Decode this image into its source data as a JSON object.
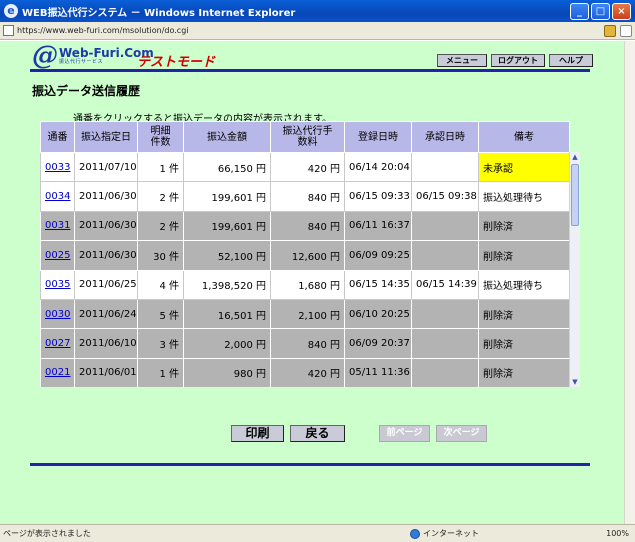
{
  "window": {
    "title": "WEB振込代行システム － Windows Internet Explorer"
  },
  "address": {
    "url": "https://www.web-furi.com/msolution/do.cgi"
  },
  "header": {
    "logo_name": "Web-Furi.Com",
    "logo_sub": "振込代行サービス",
    "mode": "テストモード",
    "nav": [
      "メニュー",
      "ログアウト",
      "ヘルプ"
    ]
  },
  "main": {
    "title": "振込データ送信履歴",
    "hint": "通番をクリックすると振込データの内容が表示されます。",
    "columns": [
      "通番",
      "振込指定日",
      "明細件数",
      "振込金額",
      "振込代行手数料",
      "登録日時",
      "承認日時",
      "備考"
    ],
    "rows": [
      {
        "id": "0033",
        "date": "2011/07/10",
        "count": "1 件",
        "amount": "66,150 円",
        "fee": "420 円",
        "registered": "06/14 20:04",
        "approved": "",
        "note": "未承認",
        "status": "pending"
      },
      {
        "id": "0034",
        "date": "2011/06/30",
        "count": "2 件",
        "amount": "199,601 円",
        "fee": "840 円",
        "registered": "06/15 09:33",
        "approved": "06/15 09:38",
        "note": "振込処理待ち",
        "status": "active"
      },
      {
        "id": "0031",
        "date": "2011/06/30",
        "count": "2 件",
        "amount": "199,601 円",
        "fee": "840 円",
        "registered": "06/11 16:37",
        "approved": "",
        "note": "削除済",
        "status": "deleted"
      },
      {
        "id": "0025",
        "date": "2011/06/30",
        "count": "30 件",
        "amount": "52,100 円",
        "fee": "12,600 円",
        "registered": "06/09 09:25",
        "approved": "",
        "note": "削除済",
        "status": "deleted"
      },
      {
        "id": "0035",
        "date": "2011/06/25",
        "count": "4 件",
        "amount": "1,398,520 円",
        "fee": "1,680 円",
        "registered": "06/15 14:35",
        "approved": "06/15 14:39",
        "note": "振込処理待ち",
        "status": "active"
      },
      {
        "id": "0030",
        "date": "2011/06/24",
        "count": "5 件",
        "amount": "16,501 円",
        "fee": "2,100 円",
        "registered": "06/10 20:25",
        "approved": "",
        "note": "削除済",
        "status": "deleted"
      },
      {
        "id": "0027",
        "date": "2011/06/10",
        "count": "3 件",
        "amount": "2,000 円",
        "fee": "840 円",
        "registered": "06/09 20:37",
        "approved": "",
        "note": "削除済",
        "status": "deleted"
      },
      {
        "id": "0021",
        "date": "2011/06/01",
        "count": "1 件",
        "amount": "980 円",
        "fee": "420 円",
        "registered": "05/11 11:36",
        "approved": "",
        "note": "削除済",
        "status": "deleted"
      }
    ]
  },
  "actions": {
    "print": "印刷",
    "back": "戻る",
    "prev": "前ページ",
    "next": "次ページ"
  },
  "status": {
    "message": "ページが表示されました",
    "zone": "インターネット",
    "zoom": "100%"
  }
}
